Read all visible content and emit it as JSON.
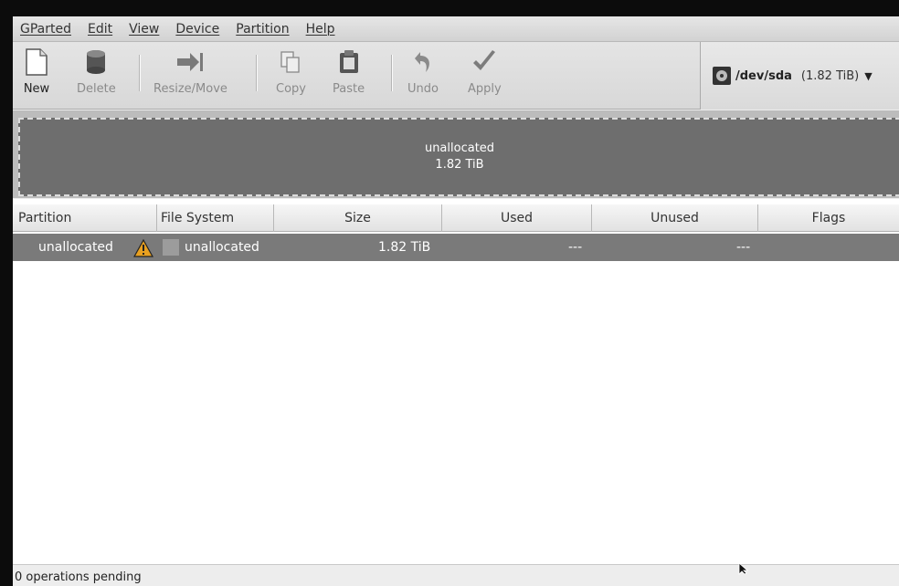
{
  "menubar": {
    "items": [
      "GParted",
      "Edit",
      "View",
      "Device",
      "Partition",
      "Help"
    ]
  },
  "toolbar": {
    "new": "New",
    "delete": "Delete",
    "resize": "Resize/Move",
    "copy": "Copy",
    "paste": "Paste",
    "undo": "Undo",
    "apply": "Apply"
  },
  "device": {
    "name": "/dev/sda",
    "size": "(1.82 TiB)"
  },
  "disk_map": {
    "label": "unallocated",
    "size": "1.82 TiB"
  },
  "table": {
    "columns": [
      "Partition",
      "File System",
      "Size",
      "Used",
      "Unused",
      "Flags"
    ],
    "rows": [
      {
        "partition": "unallocated",
        "file_system": "unallocated",
        "size": "1.82 TiB",
        "used": "---",
        "unused": "---",
        "flags": ""
      }
    ]
  },
  "status": {
    "text": "0 operations pending"
  },
  "colors": {
    "selected_row": "#7a7a7a",
    "unallocated_block": "#6e6e6e",
    "warning": "#e8a020"
  }
}
